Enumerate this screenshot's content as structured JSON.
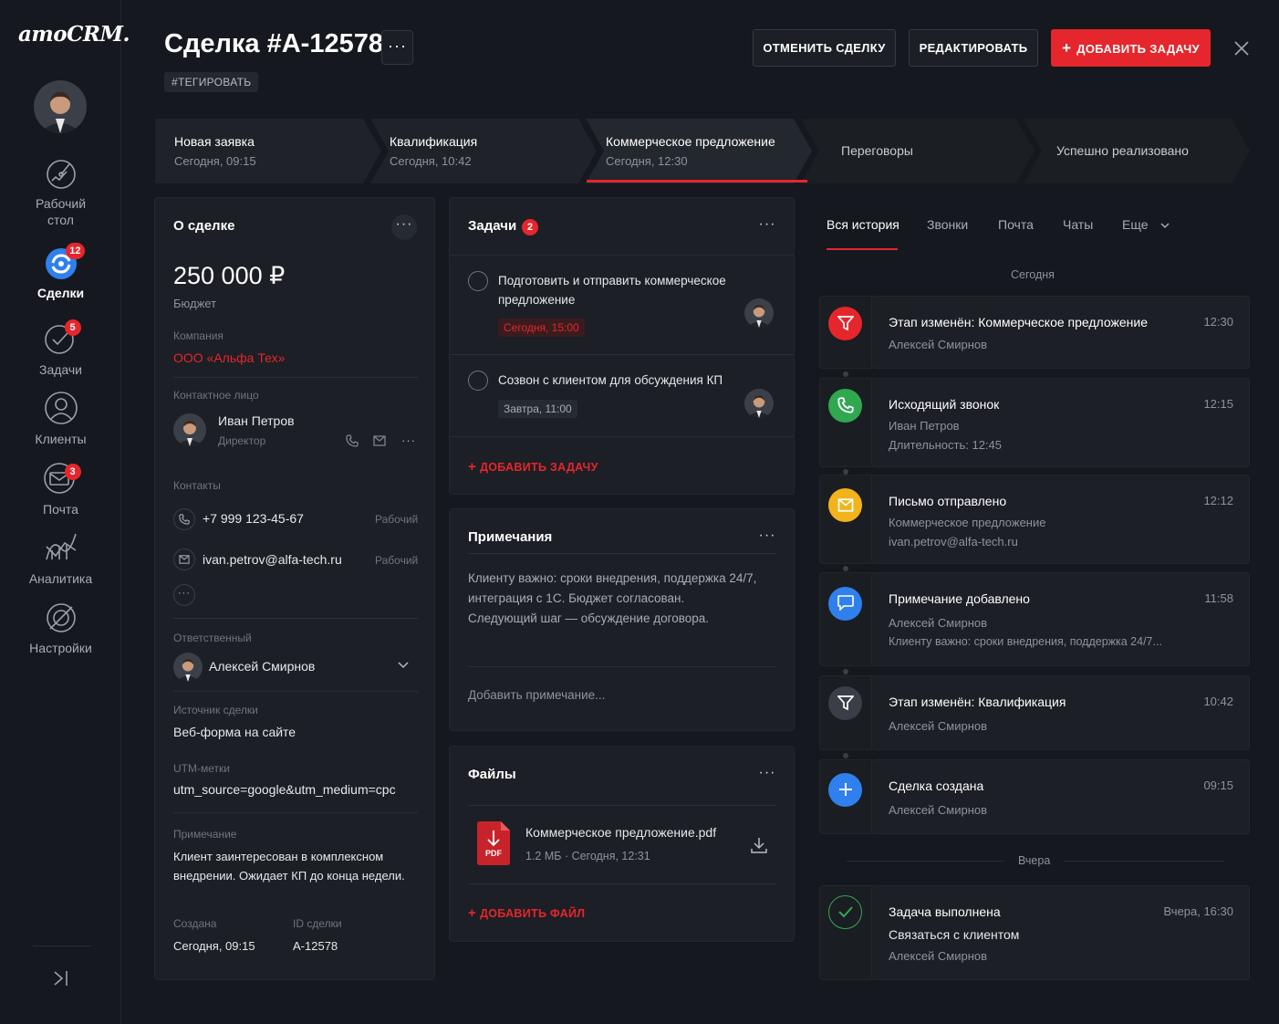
{
  "app": {
    "logo": "amoCRM."
  },
  "sidebar": {
    "items": [
      {
        "label_1": "Рабочий",
        "label_2": "стол",
        "icon": "dashboard-icon",
        "badge": ""
      },
      {
        "label_1": "Сделки",
        "label_2": "",
        "icon": "deals-icon",
        "badge": "12"
      },
      {
        "label_1": "Задачи",
        "label_2": "",
        "icon": "tasks-icon",
        "badge": "5"
      },
      {
        "label_1": "Клиенты",
        "label_2": "",
        "icon": "clients-icon",
        "badge": ""
      },
      {
        "label_1": "Почта",
        "label_2": "",
        "icon": "mail-icon",
        "badge": "3"
      },
      {
        "label_1": "Аналитика",
        "label_2": "",
        "icon": "analytics-icon",
        "badge": ""
      },
      {
        "label_1": "Настройки",
        "label_2": "",
        "icon": "settings-icon",
        "badge": ""
      }
    ]
  },
  "header": {
    "title": "Сделка #A-12578",
    "more": "···",
    "tag": "#ТЕГИРОВАТЬ",
    "cancel_label": "ОТМЕНИТЬ СДЕЛКУ",
    "edit_label": "РЕДАКТИРОВАТЬ",
    "add_task_label": "ДОБАВИТЬ ЗАДАЧУ"
  },
  "pipeline": [
    {
      "name": "Новая заявка",
      "time": "Сегодня, 09:15"
    },
    {
      "name": "Квалификация",
      "time": "Сегодня, 10:42"
    },
    {
      "name": "Коммерческое предложение",
      "time": "Сегодня, 12:30"
    },
    {
      "name": "Переговоры",
      "time": ""
    },
    {
      "name": "Успешно реализовано",
      "time": ""
    }
  ],
  "deal": {
    "title": "О сделке",
    "budget": "250 000 ₽",
    "budget_label": "Бюджет",
    "company_label": "Компания",
    "company": "ООО «Альфа Тех»",
    "contact_label": "Контактное лицо",
    "contact_name": "Иван Петров",
    "contact_role": "Директор",
    "contacts_label": "Контакты",
    "phone": "+7 999 123-45-67",
    "phone_type": "Рабочий",
    "email": "ivan.petrov@alfa-tech.ru",
    "email_type": "Рабочий",
    "responsible_label": "Ответственный",
    "responsible": "Алексей Смирнов",
    "source_label": "Источник сделки",
    "source": "Веб-форма на сайте",
    "utm_label": "UTM-метки",
    "utm": "utm_source=google&utm_medium=cpc",
    "note_label": "Примечание",
    "note_1": "Клиент заинтересован в комплексном",
    "note_2": "внедрении. Ожидает КП до конца недели.",
    "created_label": "Создана",
    "created": "Сегодня, 09:15",
    "id_label": "ID сделки",
    "id": "A-12578"
  },
  "tasks": {
    "title": "Задачи",
    "count": "2",
    "items": [
      {
        "line_1": "Подготовить и отправить коммерческое",
        "line_2": "предложение",
        "due": "Сегодня, 15:00"
      },
      {
        "line_1": "Созвон с клиентом для обсуждения КП",
        "line_2": "",
        "due": "Завтра, 11:00"
      }
    ],
    "add_label": "ДОБАВИТЬ ЗАДАЧУ"
  },
  "notes": {
    "title": "Примечания",
    "line_1": "Клиенту важно: сроки внедрения, поддержка 24/7,",
    "line_2": "интеграция с 1С. Бюджет согласован.",
    "line_3": "Следующий шаг — обсуждение договора.",
    "placeholder": "Добавить примечание..."
  },
  "files": {
    "title": "Файлы",
    "file_name": "Коммерческое предложение.pdf",
    "file_meta": "1.2 МБ · Сегодня, 12:31",
    "pdf_badge": "PDF",
    "add_label": "ДОБАВИТЬ ФАЙЛ"
  },
  "history": {
    "tabs": [
      "Вся история",
      "Звонки",
      "Почта",
      "Чаты",
      "Еще"
    ],
    "today_label": "Сегодня",
    "yesterday_label": "Вчера",
    "events": [
      {
        "title": "Этап изменён: Коммерческое предложение",
        "sub_1": "Алексей Смирнов",
        "sub_2": "",
        "time": "12:30",
        "color": "#e5262c",
        "icon": "funnel-icon"
      },
      {
        "title": "Исходящий звонок",
        "sub_1": "Иван Петров",
        "sub_2": "Длительность: 12:45",
        "time": "12:15",
        "color": "#2fa84f",
        "icon": "phone-icon"
      },
      {
        "title": "Письмо отправлено",
        "sub_1": "Коммерческое предложение",
        "sub_2": "ivan.petrov@alfa-tech.ru",
        "time": "12:12",
        "color": "#f2b31b",
        "icon": "envelope-icon"
      },
      {
        "title": "Примечание добавлено",
        "sub_1": "Алексей Смирнов",
        "sub_2": "Клиенту важно: сроки внедрения, поддержка 24/7...",
        "time": "11:58",
        "color": "#2f80ed",
        "icon": "chat-icon"
      },
      {
        "title": "Этап изменён: Квалификация",
        "sub_1": "Алексей Смирнов",
        "sub_2": "",
        "time": "10:42",
        "color": "#3a3f47",
        "icon": "funnel-icon"
      },
      {
        "title": "Сделка создана",
        "sub_1": "Алексей Смирнов",
        "sub_2": "",
        "time": "09:15",
        "color": "#2f80ed",
        "icon": "plus-icon"
      },
      {
        "title": "Задача выполнена",
        "sub_1": "Связаться с клиентом",
        "sub_2": "Алексей Смирнов",
        "time": "Вчера, 16:30",
        "color": "#2fa84f",
        "icon": "check-icon"
      }
    ]
  }
}
